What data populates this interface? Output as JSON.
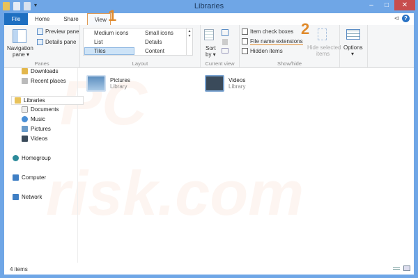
{
  "window": {
    "title": "Libraries",
    "minimize_label": "–",
    "maximize_label": "□",
    "close_label": "✕",
    "help_label": "?",
    "pin_label": "⊲"
  },
  "tabs": [
    {
      "label": "File"
    },
    {
      "label": "Home"
    },
    {
      "label": "Share"
    },
    {
      "label": "View"
    }
  ],
  "markers": {
    "one": "1",
    "two": "2"
  },
  "ribbon": {
    "panes": {
      "label": "Panes",
      "navigation_pane": "Navigation",
      "navigation_pane2": "pane ▾",
      "preview_pane": "Preview pane",
      "details_pane": "Details pane"
    },
    "layout": {
      "label": "Layout",
      "items": [
        "Medium icons",
        "Small icons",
        "List",
        "Details",
        "Tiles",
        "Content"
      ]
    },
    "current_view": {
      "label": "Current view",
      "sort_by": "Sort",
      "sort_by2": "by ▾"
    },
    "show_hide": {
      "label": "Show/hide",
      "item_check_boxes": "Item check boxes",
      "file_name_extensions": "File name extensions",
      "hidden_items": "Hidden items",
      "hide_selected": "Hide selected",
      "hide_selected2": "items"
    },
    "options": {
      "label": "Options",
      "arrow": "▾"
    }
  },
  "nav": {
    "items": [
      "Downloads",
      "Recent places",
      "Libraries",
      "Documents",
      "Music",
      "Pictures",
      "Videos",
      "Homegroup",
      "Computer",
      "Network"
    ]
  },
  "libraries": [
    {
      "name": "Pictures",
      "type": "Library"
    },
    {
      "name": "Videos",
      "type": "Library"
    }
  ],
  "status": {
    "count": "4 items"
  }
}
